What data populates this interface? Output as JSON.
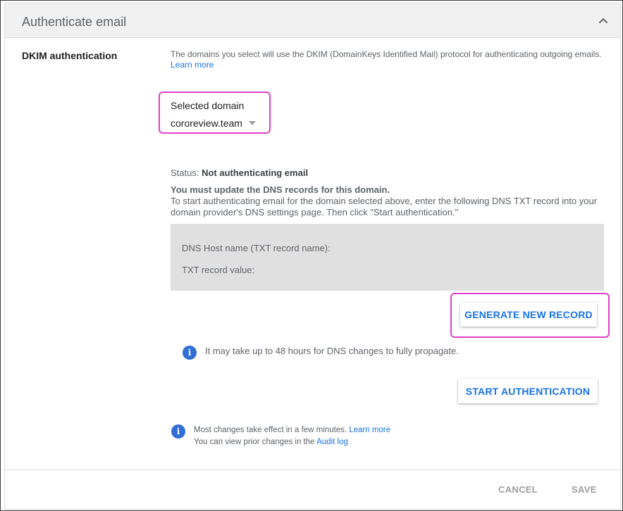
{
  "header": {
    "title": "Authenticate email",
    "collapse_icon": "chevron-up-icon"
  },
  "section": {
    "label": "DKIM authentication",
    "description": "The domains you select will use the DKIM (DomainKeys Identified Mail) protocol for authenticating outgoing emails.",
    "learn_more": "Learn more"
  },
  "domain": {
    "label": "Selected domain",
    "value": "cororeview.team"
  },
  "status": {
    "prefix": "Status:",
    "value": "Not authenticating email"
  },
  "instructions": {
    "title": "You must update the DNS records for this domain.",
    "body": "To start authenticating email for the domain selected above, enter the following DNS TXT record into your domain provider's DNS settings page. Then click \"Start authentication.\""
  },
  "dns": {
    "host_label": "DNS Host name (TXT record name):",
    "txt_label": "TXT record value:"
  },
  "buttons": {
    "generate": "GENERATE NEW RECORD",
    "start": "START AUTHENTICATION",
    "cancel": "CANCEL",
    "save": "SAVE"
  },
  "notes": {
    "propagation": "It may take up to 48 hours for DNS changes to fully propagate.",
    "changes_prefix": "Most changes take effect in a few minutes.",
    "changes_link": "Learn more",
    "audit_prefix": "You can view prior changes in the",
    "audit_link": "Audit log"
  },
  "colors": {
    "accent": "#1a73e8",
    "highlight": "#e040c8",
    "info_icon": "#2f6fd6"
  }
}
